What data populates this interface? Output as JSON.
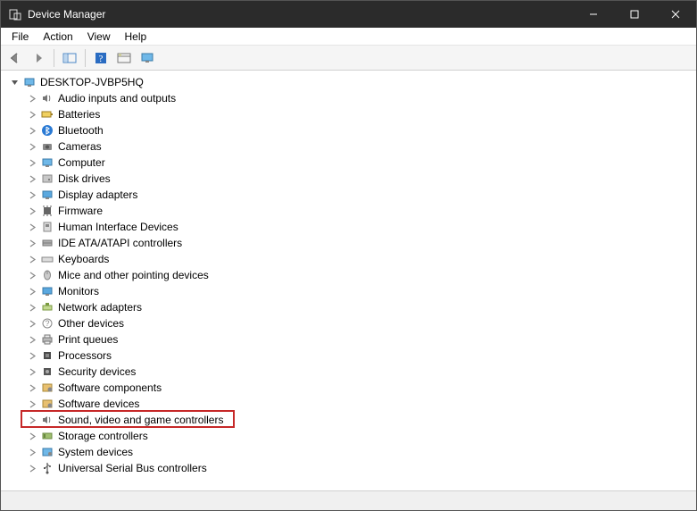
{
  "window": {
    "title": "Device Manager"
  },
  "menu": {
    "items": [
      "File",
      "Action",
      "View",
      "Help"
    ]
  },
  "toolbar": {
    "buttons": [
      {
        "name": "back-button",
        "icon": "arrow-left-icon"
      },
      {
        "name": "forward-button",
        "icon": "arrow-right-icon"
      },
      {
        "name": "sep"
      },
      {
        "name": "show-hide-button",
        "icon": "panel-icon"
      },
      {
        "name": "sep"
      },
      {
        "name": "help-button",
        "icon": "help-square-icon"
      },
      {
        "name": "properties-button",
        "icon": "properties-icon"
      },
      {
        "name": "displays-button",
        "icon": "monitor-small-icon"
      }
    ]
  },
  "tree": {
    "root": {
      "label": "DESKTOP-JVBP5HQ",
      "expanded": true
    },
    "children": [
      {
        "label": "Audio inputs and outputs",
        "icon": "speaker-icon"
      },
      {
        "label": "Batteries",
        "icon": "battery-icon"
      },
      {
        "label": "Bluetooth",
        "icon": "bluetooth-icon"
      },
      {
        "label": "Cameras",
        "icon": "camera-icon"
      },
      {
        "label": "Computer",
        "icon": "computer-icon"
      },
      {
        "label": "Disk drives",
        "icon": "disk-icon"
      },
      {
        "label": "Display adapters",
        "icon": "display-icon"
      },
      {
        "label": "Firmware",
        "icon": "chip-icon"
      },
      {
        "label": "Human Interface Devices",
        "icon": "hid-icon"
      },
      {
        "label": "IDE ATA/ATAPI controllers",
        "icon": "ide-icon"
      },
      {
        "label": "Keyboards",
        "icon": "keyboard-icon"
      },
      {
        "label": "Mice and other pointing devices",
        "icon": "mouse-icon"
      },
      {
        "label": "Monitors",
        "icon": "monitor-icon"
      },
      {
        "label": "Network adapters",
        "icon": "network-icon"
      },
      {
        "label": "Other devices",
        "icon": "other-icon"
      },
      {
        "label": "Print queues",
        "icon": "printer-icon"
      },
      {
        "label": "Processors",
        "icon": "cpu-icon"
      },
      {
        "label": "Security devices",
        "icon": "security-icon"
      },
      {
        "label": "Software components",
        "icon": "software-comp-icon"
      },
      {
        "label": "Software devices",
        "icon": "software-dev-icon"
      },
      {
        "label": "Sound, video and game controllers",
        "icon": "sound-icon",
        "highlighted": true
      },
      {
        "label": "Storage controllers",
        "icon": "storage-icon"
      },
      {
        "label": "System devices",
        "icon": "system-icon"
      },
      {
        "label": "Universal Serial Bus controllers",
        "icon": "usb-icon"
      }
    ]
  }
}
